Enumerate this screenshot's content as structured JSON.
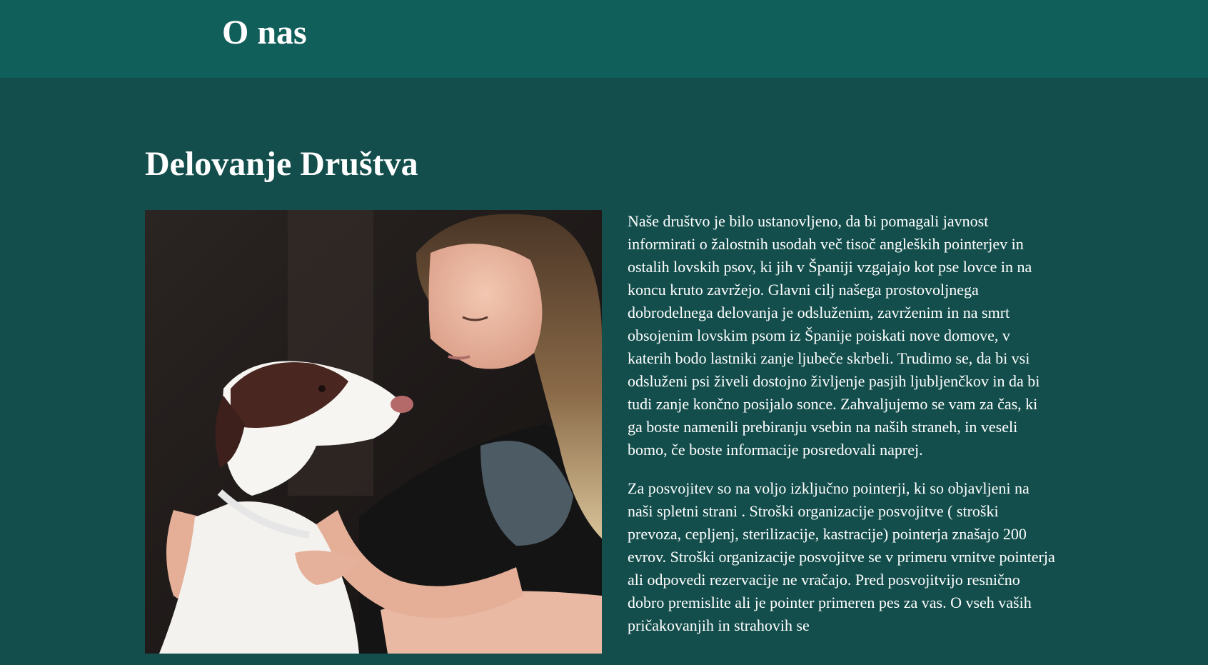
{
  "header": {
    "title": "O nas"
  },
  "main": {
    "section_title": "Delovanje Društva",
    "photo_description_icon": "dog-and-woman-photo",
    "paragraphs": [
      "Naše društvo je bilo ustanovljeno, da bi pomagali javnost informirati o žalostnih usodah več tisoč angleških pointerjev in ostalih lovskih psov, ki jih v Španiji vzgajajo kot pse lovce in na koncu kruto zavržejo. Glavni cilj našega prostovoljnega dobrodelnega delovanja je odsluženim, zavrženim in na smrt obsojenim lovskim psom iz Španije poiskati nove domove, v katerih bodo lastniki zanje ljubeče skrbeli. Trudimo se, da bi vsi odsluženi psi živeli dostojno življenje pasjih ljubljenčkov in da bi tudi zanje končno posijalo sonce. Zahvaljujemo se vam za čas, ki ga boste namenili prebiranju vsebin na naših straneh, in veseli bomo, če boste informacije posredovali naprej.",
      "Za posvojitev so na voljo izključno pointerji, ki so objavljeni na naši spletni strani . Stroški organizacije posvojitve ( stroški prevoza, cepljenj, sterilizacije, kastracije) pointerja znašajo 200 evrov. Stroški organizacije posvojitve se v primeru vrnitve pointerja ali odpovedi rezervacije ne vračajo. Pred posvojitvijo resnično dobro premislite ali je pointer primeren pes za vas. O vseh vaših pričakovanjih in strahovih se"
    ]
  },
  "colors": {
    "header_bg": "#115f5a",
    "page_bg": "#134e4c",
    "text": "#ffffff"
  }
}
